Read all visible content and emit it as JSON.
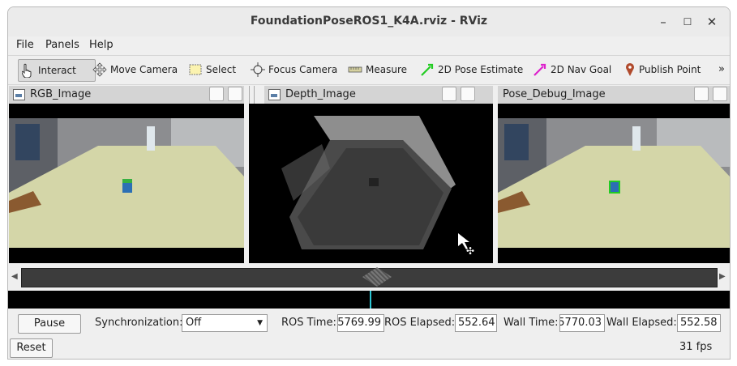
{
  "window": {
    "title": "FoundationPoseROS1_K4A.rviz - RViz"
  },
  "menu": [
    "File",
    "Panels",
    "Help"
  ],
  "toolbar": {
    "tools": [
      {
        "label": "Interact",
        "icon": "hand-pointer-icon"
      },
      {
        "label": "Move Camera",
        "icon": "move-camera-icon"
      },
      {
        "label": "Select",
        "icon": "select-icon"
      },
      {
        "label": "Focus Camera",
        "icon": "focus-camera-icon"
      },
      {
        "label": "Measure",
        "icon": "measure-icon"
      },
      {
        "label": "2D Pose Estimate",
        "icon": "pose-estimate-arrow-icon"
      },
      {
        "label": "2D Nav Goal",
        "icon": "nav-goal-arrow-icon"
      },
      {
        "label": "Publish Point",
        "icon": "map-pin-icon"
      }
    ],
    "overflow": "»"
  },
  "panels": [
    {
      "title": "RGB_Image"
    },
    {
      "title": "Depth_Image"
    },
    {
      "title": "Pose_Debug_Image"
    }
  ],
  "time": {
    "pause_label": "Pause",
    "sync_label": "Synchronization:",
    "sync_value": "Off",
    "ros_time_label": "ROS Time:",
    "ros_time_value": "5769.99",
    "ros_elapsed_label": "ROS Elapsed:",
    "ros_elapsed_value": "552.64",
    "wall_time_label": "Wall Time:",
    "wall_time_value": "5770.03",
    "wall_elapsed_label": "Wall Elapsed:",
    "wall_elapsed_value": "552.58",
    "reset_label": "Reset",
    "fps": "31 fps"
  },
  "colors": {
    "pose_estimate": "#22cc22",
    "nav_goal": "#dd22cc",
    "publish_point": "#b04a2c"
  }
}
